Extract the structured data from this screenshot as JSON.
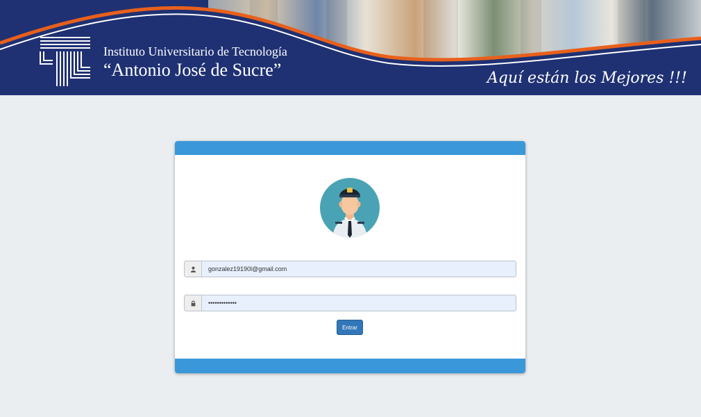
{
  "header": {
    "institution_line1": "Instituto Universitario de Tecnología",
    "institution_line2": "“Antonio José de Sucre”",
    "slogan": "Aquí están los Mejores !!!",
    "colors": {
      "banner": "#1f3173",
      "stripe": "#e8601c"
    }
  },
  "login": {
    "avatar_icon": "security-guard-avatar",
    "user_icon": "user-icon",
    "lock_icon": "lock-icon",
    "email_value": "gonzalez19190l@gmail.com",
    "password_value": "•••••••••••••",
    "submit_label": "Entrar",
    "colors": {
      "card_bar": "#3a97d9",
      "button": "#3277b8"
    }
  }
}
